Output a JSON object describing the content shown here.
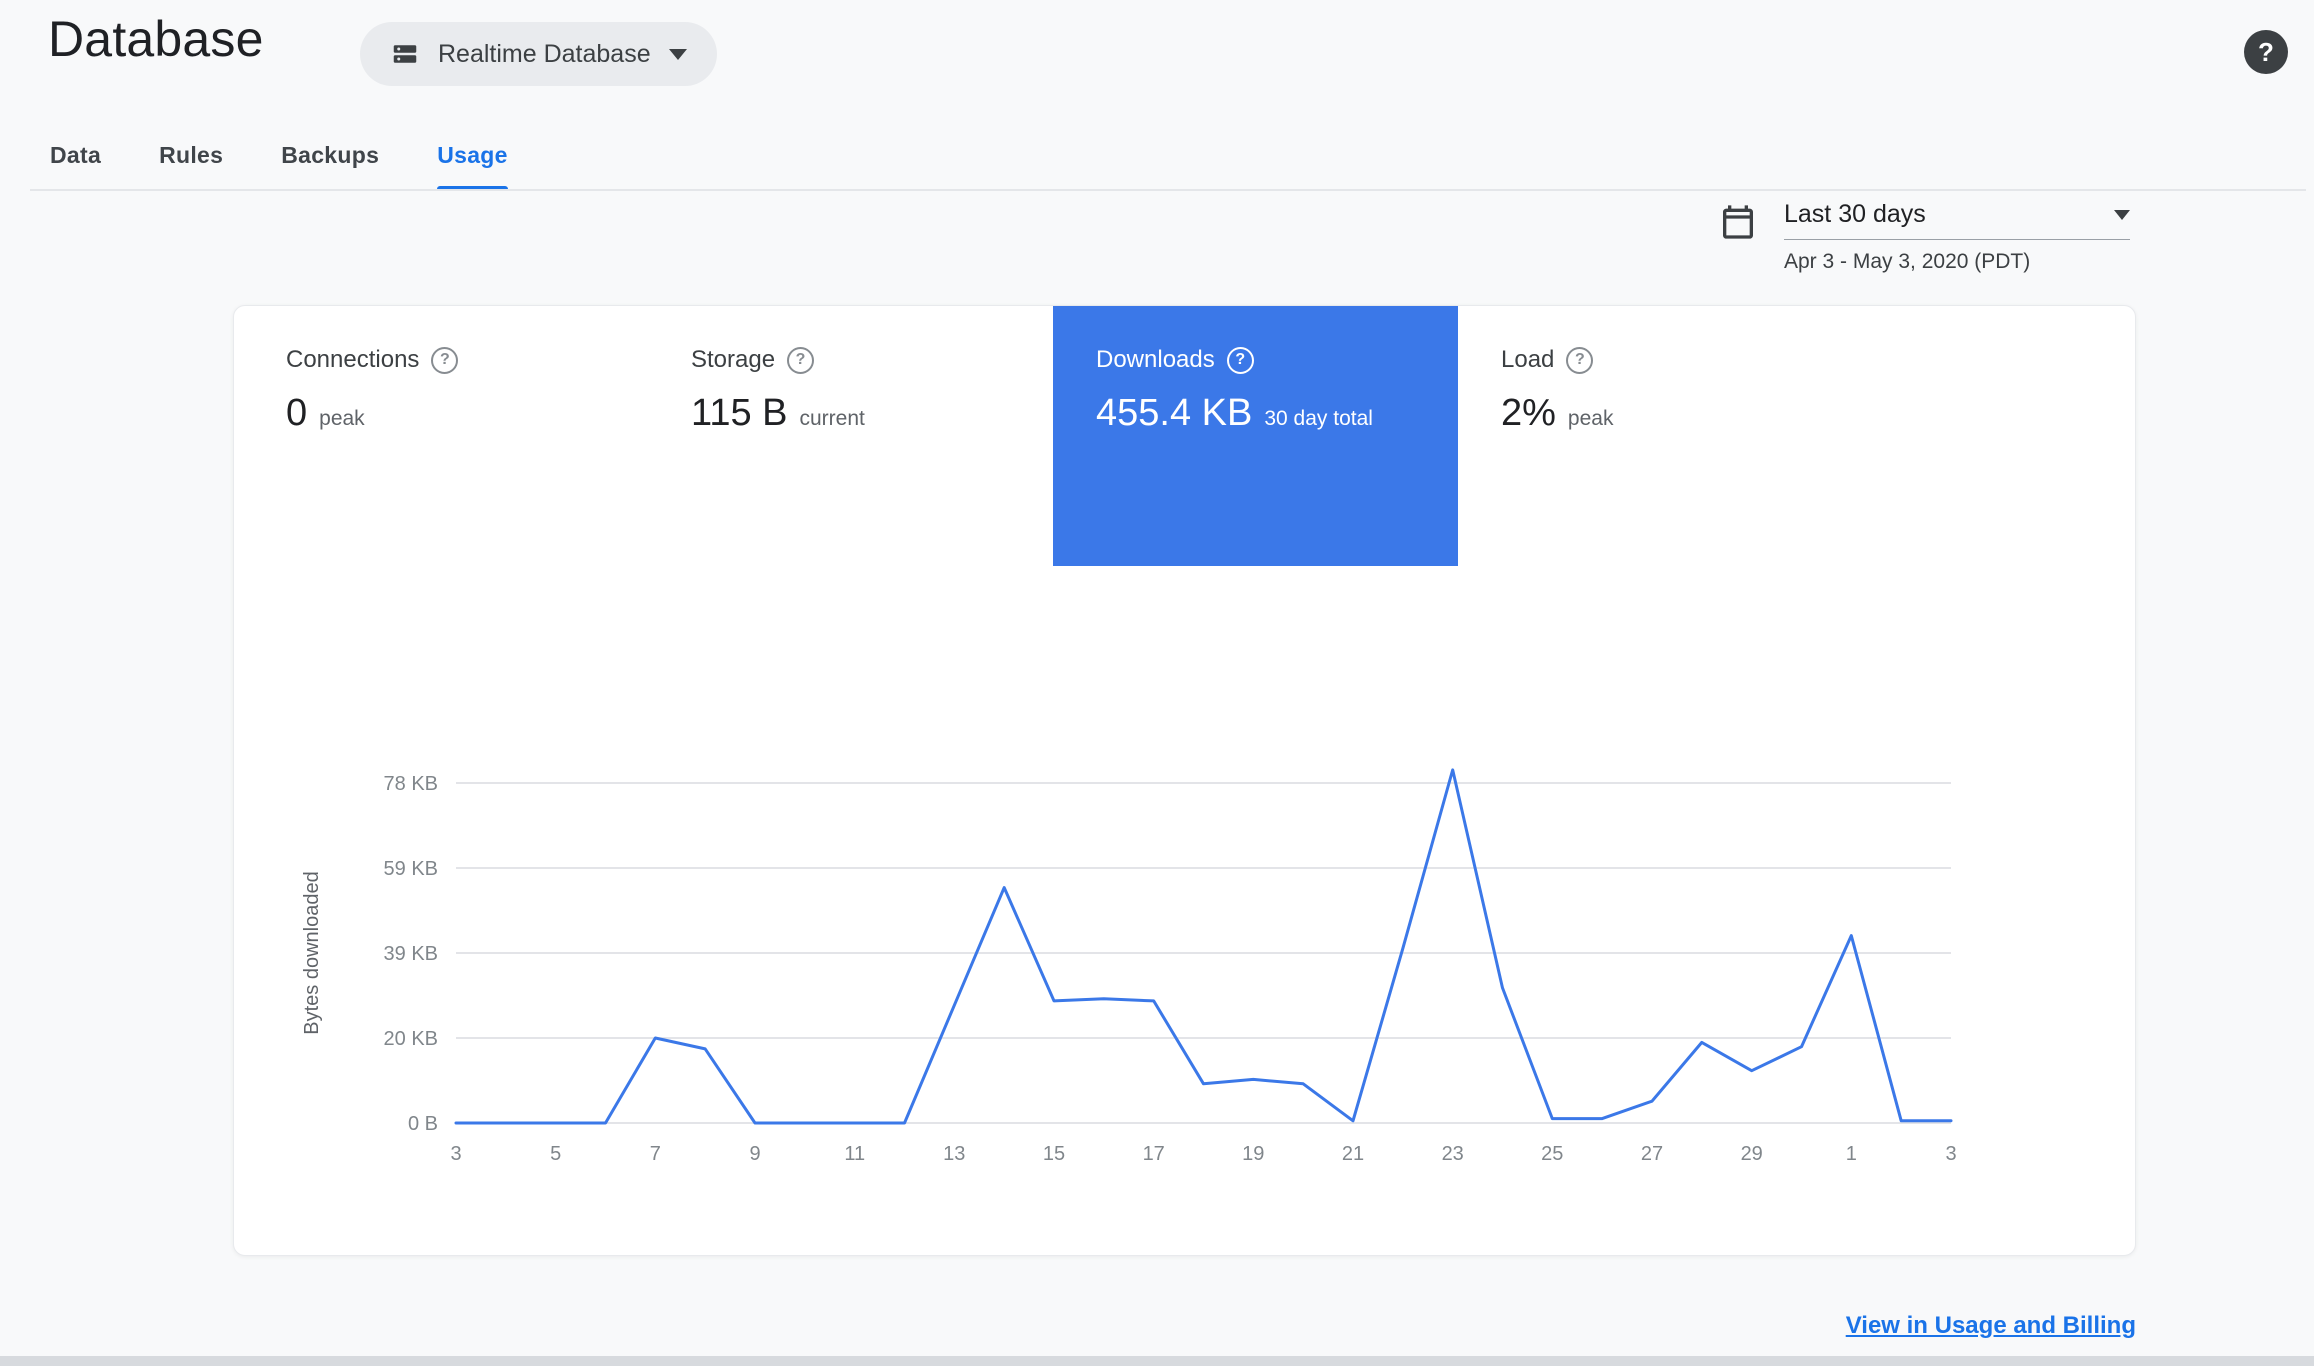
{
  "colors": {
    "accent_blue": "#1a73e8",
    "selected_tile_blue": "#3b78e8",
    "chart_line_blue": "#3b78e8",
    "page_background": "#f8f9fa"
  },
  "icons": {
    "help_glyph": "?"
  },
  "header": {
    "title": "Database",
    "database_selector_label": "Realtime Database"
  },
  "tabs": [
    {
      "label": "Data",
      "active": false
    },
    {
      "label": "Rules",
      "active": false
    },
    {
      "label": "Backups",
      "active": false
    },
    {
      "label": "Usage",
      "active": true
    }
  ],
  "date_range": {
    "label": "Last 30 days",
    "detail": "Apr 3 - May 3, 2020 (PDT)"
  },
  "metrics": [
    {
      "name": "Connections",
      "value": "0",
      "unit": "peak",
      "selected": false
    },
    {
      "name": "Storage",
      "value": "115 B",
      "unit": "current",
      "selected": false
    },
    {
      "name": "Downloads",
      "value": "455.4 KB",
      "unit": "30 day total",
      "selected": true
    },
    {
      "name": "Load",
      "value": "2%",
      "unit": "peak",
      "selected": false
    }
  ],
  "chart_data": {
    "type": "line",
    "ylabel": "Bytes downloaded",
    "line_color": "#3b78e8",
    "grid": true,
    "legend": "none",
    "ylim_kb": [
      0,
      78
    ],
    "y_ticks": [
      {
        "label": "78 KB",
        "value_kb": 78
      },
      {
        "label": "59 KB",
        "value_kb": 58.5
      },
      {
        "label": "39 KB",
        "value_kb": 39
      },
      {
        "label": "20 KB",
        "value_kb": 19.5
      },
      {
        "label": "0 B",
        "value_kb": 0
      }
    ],
    "x_days": [
      3,
      4,
      5,
      6,
      7,
      8,
      9,
      10,
      11,
      12,
      13,
      14,
      15,
      16,
      17,
      18,
      19,
      20,
      21,
      22,
      23,
      24,
      25,
      26,
      27,
      28,
      29,
      30,
      1,
      2,
      3
    ],
    "x_tick_labels": [
      "3",
      "5",
      "7",
      "9",
      "11",
      "13",
      "15",
      "17",
      "19",
      "21",
      "23",
      "25",
      "27",
      "29",
      "1",
      "3"
    ],
    "values_kb": [
      0,
      0,
      0,
      0,
      19.5,
      17,
      0,
      0,
      0,
      0,
      27,
      54,
      28,
      28.5,
      28,
      9,
      10,
      9,
      0.5,
      40,
      81,
      31,
      1,
      1,
      5,
      18.5,
      12,
      17.5,
      43,
      0.5,
      0.5
    ]
  },
  "footer": {
    "link_label": "View in Usage and Billing"
  }
}
